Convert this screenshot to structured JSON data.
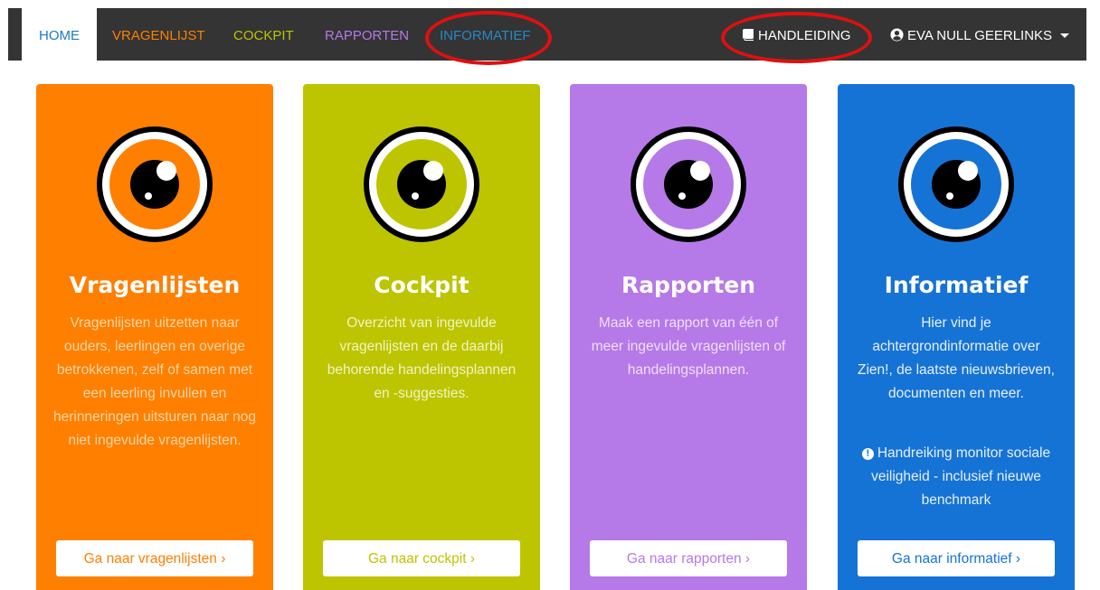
{
  "nav": {
    "home": "HOME",
    "vragenlijst": "VRAGENLIJST",
    "cockpit": "COCKPIT",
    "rapporten": "RAPPORTEN",
    "informatief": "INFORMATIEF",
    "handleiding": "HANDLEIDING",
    "user": "EVA NULL GEERLINKS",
    "icons": {
      "handleiding": "book-icon",
      "user": "user-circle-icon",
      "user_menu": "caret-down-icon"
    }
  },
  "colors": {
    "navbar": "#343434",
    "orange": "#ff7f00",
    "green": "#bdc400",
    "purple": "#b679e8",
    "blue": "#1673d6",
    "highlight": "#e01010"
  },
  "cards": [
    {
      "title": "Vragenlijsten",
      "text": "Vragenlijsten uitzetten naar ouders, leerlingen en overige betrokkenen, zelf of samen met een leerling invullen en herinneringen uitsturen naar nog niet ingevulde vragenlijsten.",
      "button": "Ga naar vragenlijsten ›",
      "icon": "eye-icon"
    },
    {
      "title": "Cockpit",
      "text": "Overzicht van ingevulde vragenlijsten en de daarbij behorende handelingsplannen en -suggesties.",
      "button": "Ga naar cockpit ›",
      "icon": "eye-icon"
    },
    {
      "title": "Rapporten",
      "text": "Maak een rapport van één of meer ingevulde vragenlijsten of handelingsplannen.",
      "button": "Ga naar rapporten ›",
      "icon": "eye-icon"
    },
    {
      "title": "Informatief",
      "text": "Hier vind je achtergrondinformatie over Zien!, de laatste nieuwsbrieven, documenten en meer.",
      "note": "Handreiking monitor sociale veiligheid - inclusief nieuwe benchmark",
      "button": "Ga naar informatief ›",
      "icon": "eye-icon"
    }
  ]
}
